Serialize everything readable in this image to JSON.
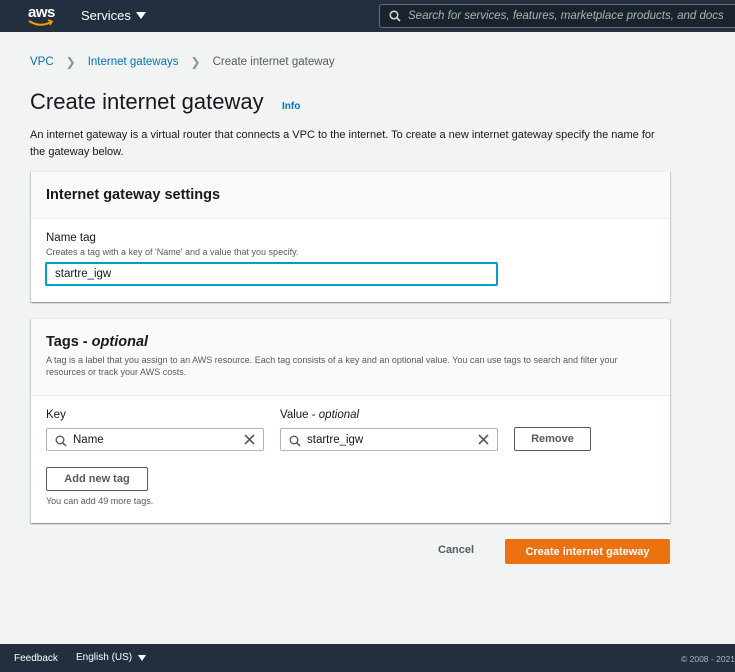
{
  "nav": {
    "logo_text": "aws",
    "services_label": "Services",
    "search_placeholder": "Search for services, features, marketplace products, and docs"
  },
  "breadcrumb": {
    "items": [
      "VPC",
      "Internet gateways"
    ],
    "current": "Create internet gateway"
  },
  "header": {
    "title": "Create internet gateway",
    "info": "Info",
    "description": "An internet gateway is a virtual router that connects a VPC to the internet. To create a new internet gateway specify the name for the gateway below."
  },
  "settings": {
    "title": "Internet gateway settings",
    "name_label": "Name tag",
    "name_sublabel": "Creates a tag with a key of 'Name' and a value that you specify.",
    "name_value": "startre_igw"
  },
  "tags": {
    "title": "Tags - ",
    "title_optional": "optional",
    "description": "A tag is a label that you assign to an AWS resource. Each tag consists of a key and an optional value. You can use tags to search and filter your resources or track your AWS costs.",
    "key_label": "Key",
    "value_label": "Value - ",
    "value_optional": "optional",
    "key_value": "Name",
    "value_value": "startre_igw",
    "remove_label": "Remove",
    "add_label": "Add new tag",
    "hint": "You can add 49 more tags."
  },
  "actions": {
    "cancel": "Cancel",
    "create": "Create internet gateway"
  },
  "footer": {
    "feedback": "Feedback",
    "language": "English (US)",
    "copyright": "© 2008 - 2021"
  },
  "colors": {
    "nav_bg": "#232f3e",
    "link": "#0073bb",
    "primary": "#ec7211",
    "focus": "#00a1c9",
    "logo_smile": "#ff9900"
  }
}
